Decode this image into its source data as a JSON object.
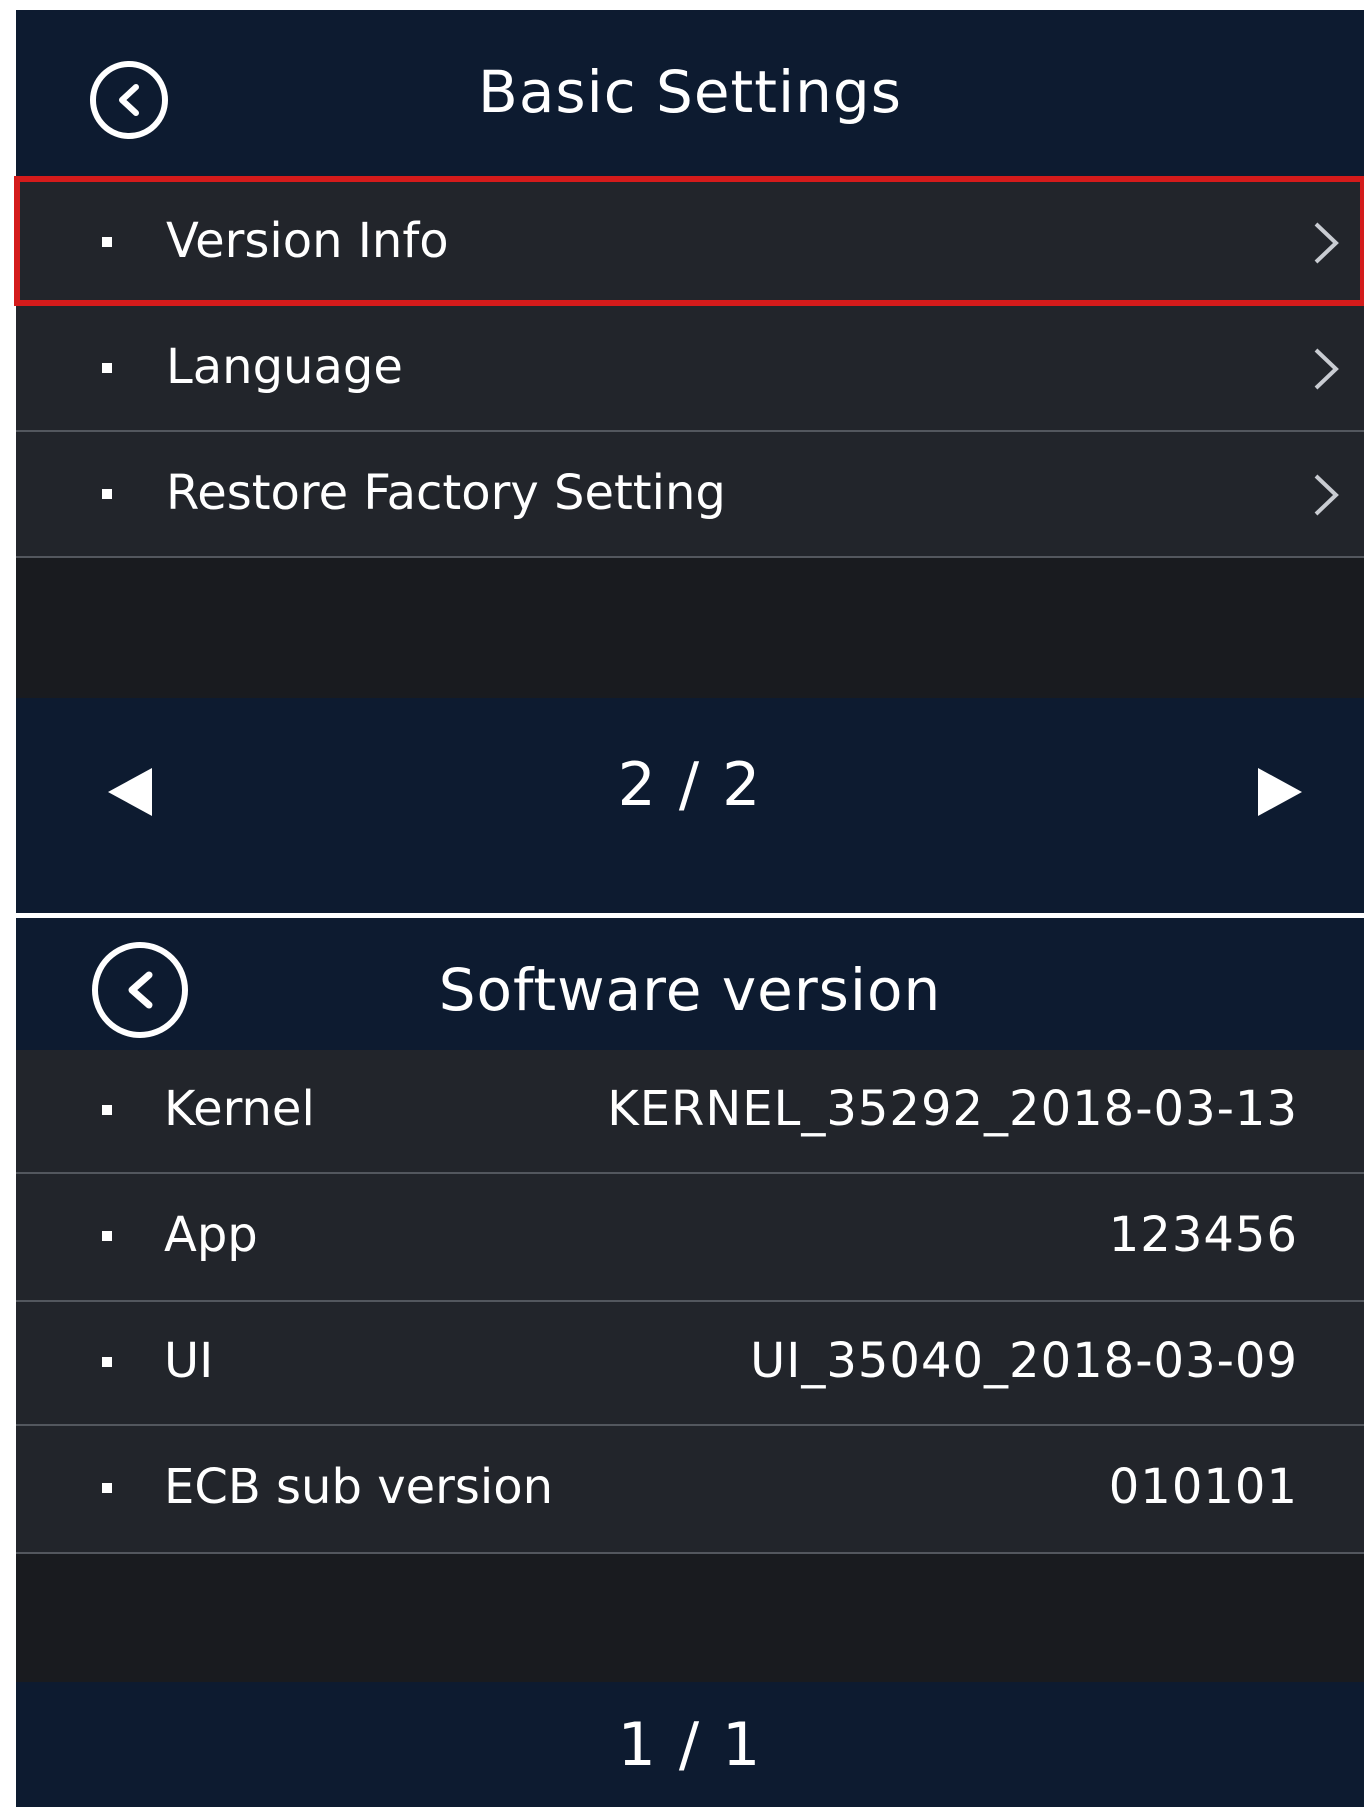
{
  "screen1": {
    "title": "Basic Settings",
    "icons": {
      "back": "back-circle-icon",
      "chevron": "chevron-right-icon",
      "prev": "triangle-left-icon",
      "next": "triangle-right-icon"
    },
    "items": [
      {
        "label": "Version Info",
        "selected": true
      },
      {
        "label": "Language",
        "selected": false
      },
      {
        "label": "Restore Factory Setting",
        "selected": false
      }
    ],
    "page_indicator": "2 / 2"
  },
  "screen2": {
    "title": "Software version",
    "items": [
      {
        "label": "Kernel",
        "value": "KERNEL_35292_2018-03-13"
      },
      {
        "label": "App",
        "value": "123456"
      },
      {
        "label": "UI",
        "value": "UI_35040_2018-03-09"
      },
      {
        "label": "ECB sub version",
        "value": "010101"
      }
    ],
    "page_indicator": "1 / 1"
  },
  "colors": {
    "header_bg": "#0d1b30",
    "row_bg": "#22252b",
    "selection_outline": "#d41b1b",
    "text": "#ffffff"
  }
}
